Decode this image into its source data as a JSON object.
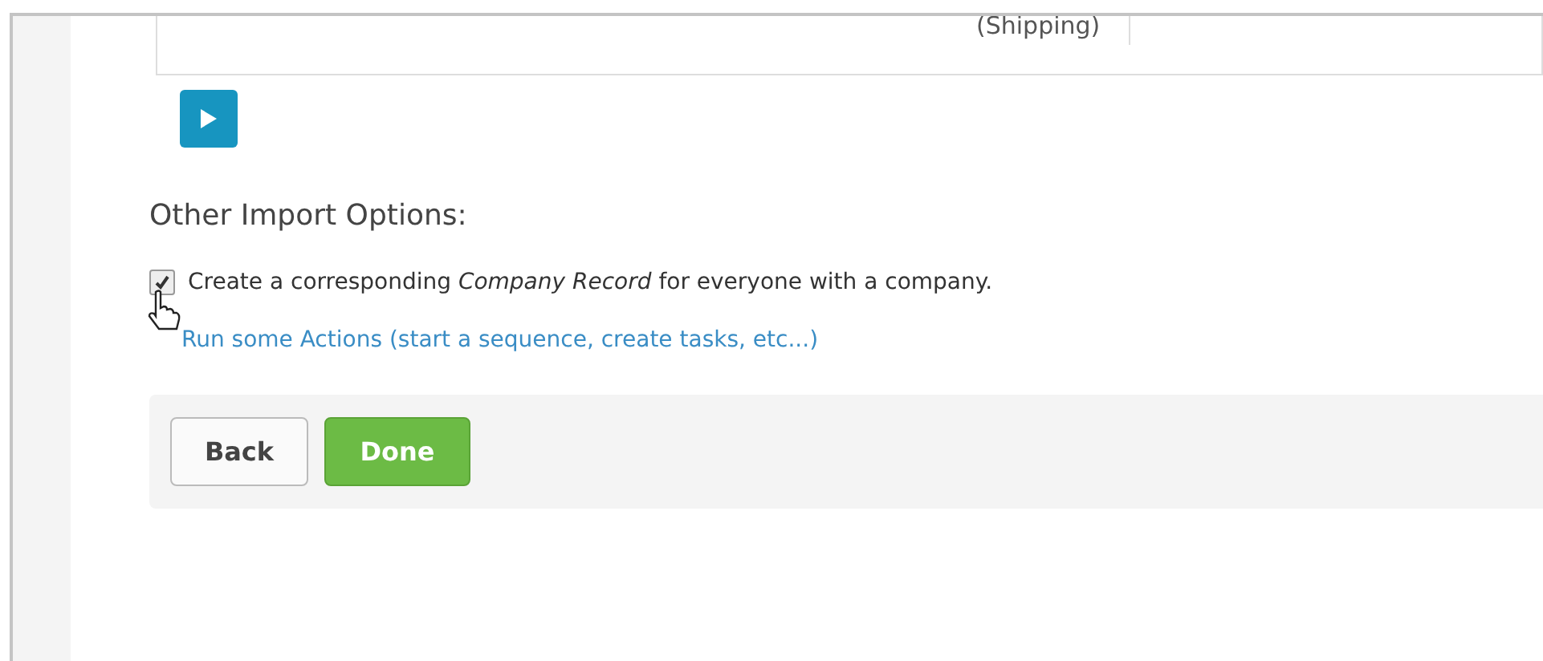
{
  "table": {
    "cell": "(Shipping)"
  },
  "section": {
    "title": "Other Import Options:"
  },
  "options": [
    {
      "kind": "checkbox",
      "label": "Create a corresponding *Company Record* for everyone with a company.",
      "checked": true
    },
    {
      "kind": "link",
      "label": "Run some Actions (start a sequence, create tasks, etc...)"
    }
  ],
  "buttons": [
    {
      "label": "Back",
      "kind": "default"
    },
    {
      "label": "Done",
      "kind": "primary"
    }
  ]
}
